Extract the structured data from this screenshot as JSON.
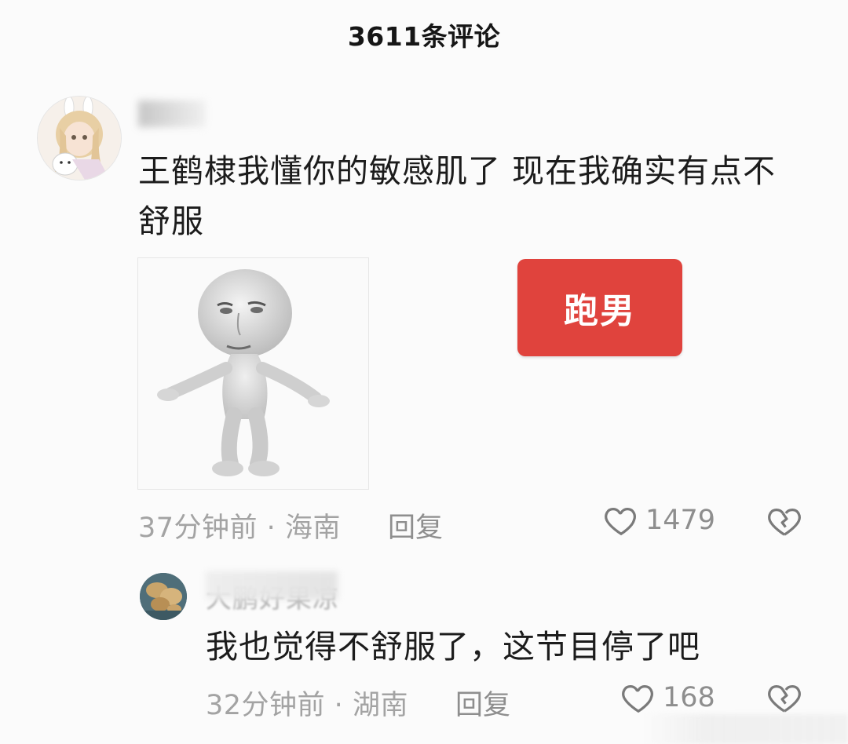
{
  "header": {
    "title": "3611条评论"
  },
  "comment": {
    "avatar_icon": "anime-girl-avatar",
    "text_line1": "王鹤棣我懂你的敏感肌了 现在我确实有点不",
    "text_line2": "舒服",
    "tag_label": "跑男",
    "tag_color": "#e0433d",
    "time": "37分钟前",
    "location": "海南",
    "reply_label": "回复",
    "likes": "1479"
  },
  "reply": {
    "avatar_icon": "food-photo-avatar",
    "username": "大鹏好果凉",
    "text": "我也觉得不舒服了，这节目停了吧",
    "time": "32分钟前",
    "location": "湖南",
    "reply_label": "回复",
    "likes": "168"
  },
  "separator": " · "
}
